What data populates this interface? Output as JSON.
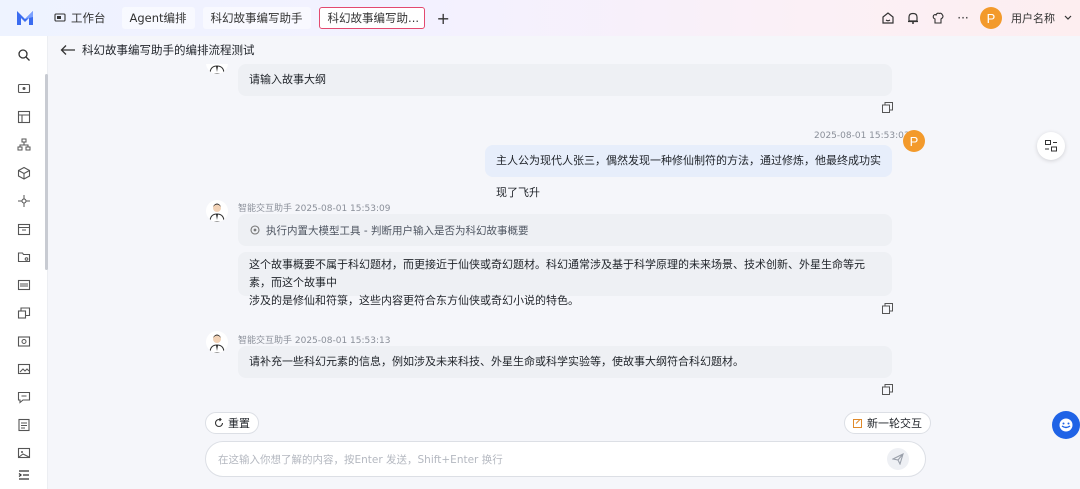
{
  "app": {
    "tabs": [
      {
        "label": "工作台"
      },
      {
        "label": "Agent编排"
      },
      {
        "label": "科幻故事编写助手"
      },
      {
        "label": "科幻故事编写助..."
      }
    ],
    "user_initial": "P",
    "username": "用户名称",
    "more": "···"
  },
  "page": {
    "title": "科幻故事编写助手的编排流程测试"
  },
  "messages": {
    "m1": {
      "text": "请输入故事大纲"
    },
    "m2": {
      "time": "2025-08-01 15:53:03",
      "text": "主人公为现代人张三，偶然发现一种修仙制符的方法，通过修炼，他最终成功实现了飞升",
      "avatar": "P"
    },
    "m3": {
      "meta": "智能交互助手 2025-08-01 15:53:09",
      "tool": "执行内置大模型工具 - 判断用户输入是否为科幻故事概要",
      "line1": "这个故事概要不属于科幻题材，而更接近于仙侠或奇幻题材。科幻通常涉及基于科学原理的未来场景、技术创新、外星生命等元素，而这个故事中",
      "line2": "涉及的是修仙和符箓，这些内容更符合东方仙侠或奇幻小说的特色。"
    },
    "m4": {
      "meta": "智能交互助手 2025-08-01 15:53:13",
      "text": "请补充一些科幻元素的信息，例如涉及未来科技、外星生命或科学实验等，使故事大纲符合科幻题材。"
    }
  },
  "controls": {
    "reset_label": "重置",
    "new_round_label": "新一轮交互",
    "input_placeholder": "在这输入你想了解的内容，按Enter 发送，Shift+Enter 换行"
  }
}
